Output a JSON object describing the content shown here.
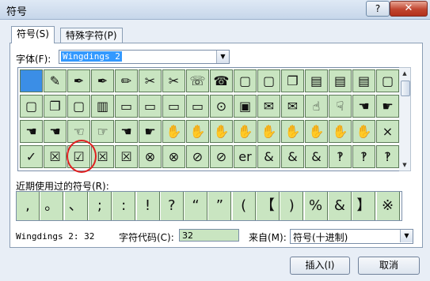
{
  "window": {
    "title": "符号",
    "help_label": "?",
    "close_label": "✕"
  },
  "tabs": [
    {
      "label": "符号(S)"
    },
    {
      "label": "特殊字符(P)"
    }
  ],
  "font": {
    "label": "字体(F):",
    "value": "Wingdings 2"
  },
  "symbol_grid": {
    "rows": [
      [
        "",
        "✎",
        "✒",
        "✒",
        "✏",
        "✂",
        "✂",
        "☏",
        "☎",
        "▢",
        "▢",
        "❐",
        "▤",
        "▤",
        "▤",
        "▢"
      ],
      [
        "▢",
        "❐",
        "▢",
        "▥",
        "▭",
        "▭",
        "▭",
        "▭",
        "⊙",
        "▣",
        "✉",
        "✉",
        "☝",
        "☟",
        "☚",
        "☛"
      ],
      [
        "☚",
        "☚",
        "☜",
        "☞",
        "☚",
        "☛",
        "✋",
        "✋",
        "✋",
        "✋",
        "✋",
        "✋",
        "✋",
        "✋",
        "✋",
        "×"
      ],
      [
        "✓",
        "☒",
        "☑",
        "☒",
        "☒",
        "⊗",
        "⊗",
        "⊘",
        "⊘",
        "er",
        "&",
        "&",
        "&",
        "‽",
        "‽",
        "‽"
      ]
    ],
    "selected_index": 0,
    "highlighted": "☑"
  },
  "recent": {
    "label": "近期使用过的符号(R):",
    "symbols": [
      ",",
      "。",
      "、",
      ";",
      ":",
      "!",
      "?",
      "“",
      "”",
      "(",
      "【",
      ")",
      "%",
      "&",
      "】",
      "※"
    ]
  },
  "status": {
    "font_code": "Wingdings 2: 32"
  },
  "char_code": {
    "label": "字符代码(C):",
    "value": "32"
  },
  "from": {
    "label": "来自(M):",
    "value": "符号(十进制)"
  },
  "buttons": {
    "insert": "插入(I)",
    "cancel": "取消"
  }
}
